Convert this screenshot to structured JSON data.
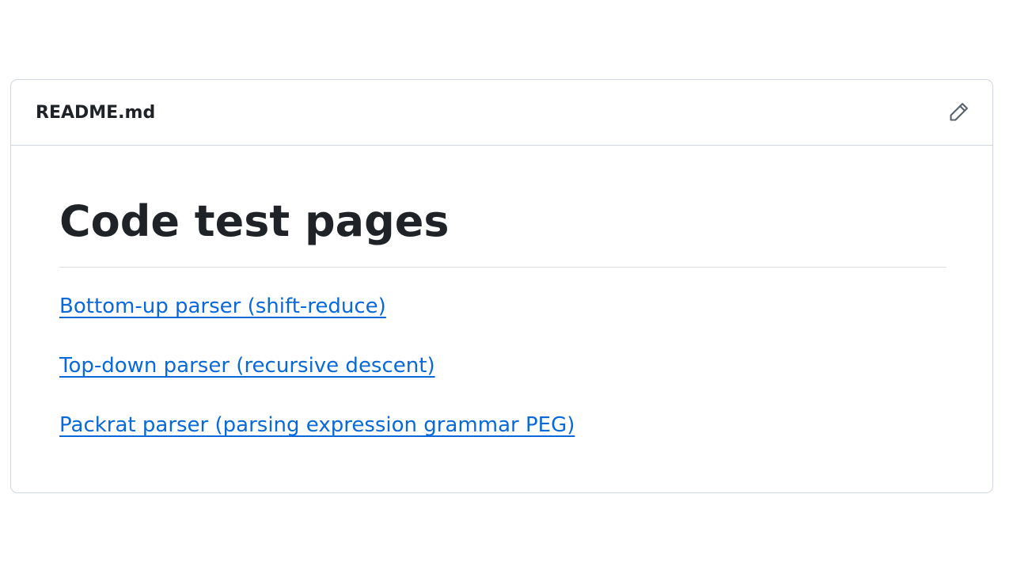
{
  "readme": {
    "filename": "README.md",
    "edit_icon": "pencil-icon",
    "heading": "Code test pages",
    "links": [
      "Bottom-up parser (shift-reduce)",
      "Top-down parser (recursive descent)",
      "Packrat parser (parsing expression grammar PEG)"
    ]
  },
  "colors": {
    "link": "#0969da",
    "text": "#1f2328",
    "border": "#d0d7de"
  }
}
